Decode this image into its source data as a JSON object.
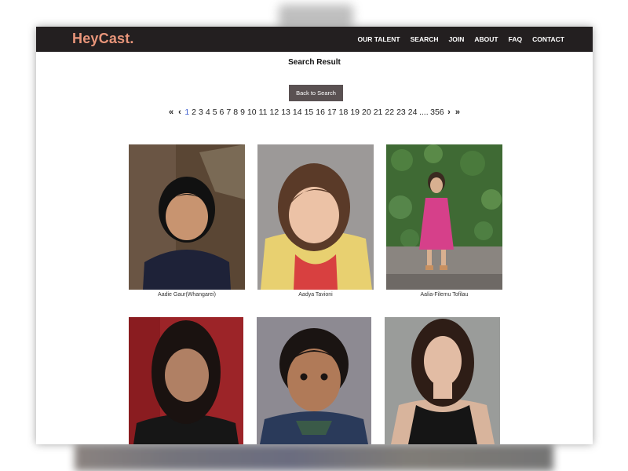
{
  "brand": {
    "logo_text": "HeyCast."
  },
  "nav": {
    "items": [
      {
        "label": "OUR TALENT"
      },
      {
        "label": "SEARCH"
      },
      {
        "label": "JOIN"
      },
      {
        "label": "ABOUT"
      },
      {
        "label": "FAQ"
      },
      {
        "label": "CONTACT"
      }
    ]
  },
  "main": {
    "title": "Search Result",
    "back_button_label": "Back to Search"
  },
  "pagination": {
    "first": "«",
    "prev": "‹",
    "next": "›",
    "last": "»",
    "current_page": "1",
    "pages": [
      "1",
      "2",
      "3",
      "4",
      "5",
      "6",
      "7",
      "8",
      "9",
      "10",
      "11",
      "12",
      "13",
      "14",
      "15",
      "16",
      "17",
      "18",
      "19",
      "20",
      "21",
      "22",
      "23",
      "24"
    ],
    "ellipsis": "....",
    "last_page": "356"
  },
  "talent": [
    {
      "name": "Aadie Gaur(Whangarei)"
    },
    {
      "name": "Aadya Tavioni"
    },
    {
      "name": "Aalia-Filemu Tofilau"
    },
    {
      "name": ""
    },
    {
      "name": ""
    },
    {
      "name": ""
    }
  ],
  "colors": {
    "navbar_bg": "#231f20",
    "logo": "#e8957a",
    "button_bg": "#5a5152",
    "active_page": "#3d5fd0"
  }
}
